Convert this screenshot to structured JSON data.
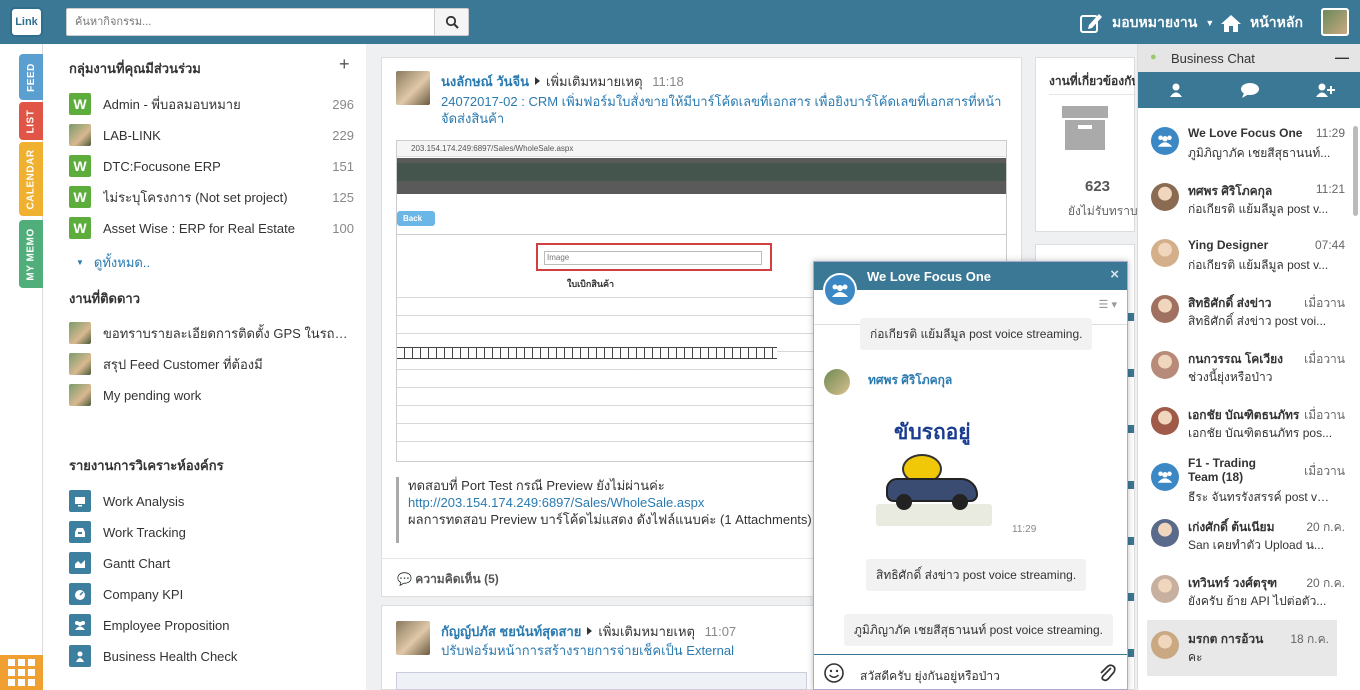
{
  "header": {
    "logo": "Link",
    "search_placeholder": "ค้นหากิจกรรม...",
    "assign_label": "มอบหมายงาน",
    "home_label": "หน้าหลัก"
  },
  "sidetabs": [
    "FEED",
    "LIST",
    "CALENDAR",
    "MY MEMO"
  ],
  "groups": {
    "title": "กลุ่มงานที่คุณมีส่วนร่วม",
    "add": "+",
    "items": [
      {
        "label": "Admin - พี่บอลมอบหมาย",
        "count": "296",
        "icon": "W"
      },
      {
        "label": "LAB-LINK",
        "count": "229",
        "icon": "photo"
      },
      {
        "label": "DTC:Focusone ERP",
        "count": "151",
        "icon": "W"
      },
      {
        "label": "ไม่ระบุโครงการ (Not set project)",
        "count": "125",
        "icon": "W"
      },
      {
        "label": "Asset Wise : ERP for Real Estate",
        "count": "100",
        "icon": "W"
      }
    ],
    "see_all": "ดูทั้งหมด.."
  },
  "follow": {
    "title": "งานที่ติดดาว",
    "items": [
      {
        "label": "ขอทราบรายละเอียดการติดตั้ง GPS ในรถโค..."
      },
      {
        "label": "สรุป Feed Customer ที่ต้องมี"
      },
      {
        "label": "My pending work"
      }
    ]
  },
  "reports": {
    "title": "รายงานการวิเคราะห์องค์กร",
    "items": [
      {
        "label": "Work Analysis",
        "icon": "monitor-icon"
      },
      {
        "label": "Work Tracking",
        "icon": "inbox-icon"
      },
      {
        "label": "Gantt Chart",
        "icon": "area-chart-icon"
      },
      {
        "label": "Company KPI",
        "icon": "dashboard-icon"
      },
      {
        "label": "Employee Proposition",
        "icon": "users-icon"
      },
      {
        "label": "Business Health Check",
        "icon": "user-icon"
      }
    ]
  },
  "post1": {
    "author": "นงลักษณ์ วันจีน",
    "action": "เพิ่มเติมหมายเหตุ",
    "time": "11:18",
    "title": "24072017-02 : CRM เพิ่มฟอร์มใบสั่งขายให้มีบาร์โค้ดเลขที่เอกสาร เพื่อยิงบาร์โค้ดเลขที่เอกสารที่หน้าจัดส่งสินค้า",
    "screenshot_url": "203.154.174.249:6897/Sales/WholeSale.aspx",
    "screenshot_back": "Back",
    "screenshot_img": "Image",
    "screenshot_doc_title": "ใบเบิกสินค้า",
    "quote_line1": "ทดสอบที่ Port Test กรณี Preview ยังไม่ผ่านค่ะ",
    "quote_link": "http://203.154.174.249:6897/Sales/WholeSale.aspx",
    "quote_line3": "ผลการทดสอบ Preview บาร์โค้ดไม่แสดง ดังไฟล์แนบค่ะ (1 Attachments)",
    "comments": "ความคิดเห็น (5)"
  },
  "post2": {
    "author": "กัญญ์ปภัส ชยนันท์สุดสาย",
    "action": "เพิ่มเติมหมายเหตุ",
    "time": "11:07",
    "title": "ปรับฟอร์มหน้าการสร้างรายการจ่ายเช็คเป็น External"
  },
  "mid": {
    "title": "งานที่เกี่ยวข้องกับ",
    "count": "623",
    "count_label": "ยังไม่รับทราบ"
  },
  "chatwin": {
    "title": "We Love Focus One",
    "close": "×",
    "messages": [
      {
        "text": "ก่อเกียรติ แย้มลีมูล post voice streaming."
      },
      {
        "sender": "ทศพร ศิริโภคกุล",
        "sticker_text": "ขับรถอยู่",
        "time": "11:29"
      },
      {
        "text": "สิทธิศักดิ์ ส่งข่าว post voice streaming."
      },
      {
        "text": "ภูมิภิญาภัค เชยสีสุธานนท์ post voice streaming."
      }
    ],
    "input_value": "สวัสดีครับ ยุ่งกันอยู่หรือป่าว"
  },
  "business_chat": {
    "title": "Business Chat",
    "minimize": "—",
    "items": [
      {
        "name": "We Love Focus One",
        "time": "11:29",
        "preview": "ภูมิภิญาภัค เชยสีสุธานนท์...",
        "avatar": "group"
      },
      {
        "name": "ทศพร ศิริโภคกุล",
        "time": "11:21",
        "preview": "ก่อเกียรติ แย้มลีมูล post v...",
        "avatar": "photo"
      },
      {
        "name": "Ying Designer",
        "time": "07:44",
        "preview": "ก่อเกียรติ แย้มลีมูล post v...",
        "avatar": "photo"
      },
      {
        "name": "สิทธิศักดิ์ ส่งข่าว",
        "time": "เมื่อวาน",
        "preview": "สิทธิศักดิ์ ส่งข่าว post voi...",
        "avatar": "photo"
      },
      {
        "name": "กนกวรรณ โคเวียง",
        "time": "เมื่อวาน",
        "preview": "ช่วงนี้ยุ่งหรือป่าว",
        "avatar": "photo"
      },
      {
        "name": "เอกชัย บัณฑิตธนภัทร",
        "time": "เมื่อวาน",
        "preview": "เอกชัย บัณฑิตธนภัทร pos...",
        "avatar": "photo"
      },
      {
        "name": "F1 - Trading Team (18)",
        "time": "เมื่อวาน",
        "preview": "ธีระ จันทรรังสรรค์ post vo...",
        "avatar": "group"
      },
      {
        "name": "เก่งศักดิ์ ต้นเนียม",
        "time": "20 ก.ค.",
        "preview": "San เคยทำตัว Upload น...",
        "avatar": "photo"
      },
      {
        "name": "เทวินทร์ วงศ์ตรุฑ",
        "time": "20 ก.ค.",
        "preview": "ยังครับ ย้าย API ไปต่อตัว...",
        "avatar": "photo"
      },
      {
        "name": "มรกต การอ้วน",
        "time": "18 ก.ค.",
        "preview": "คะ",
        "avatar": "photo"
      }
    ]
  },
  "colors": {
    "brand": "#3b7895",
    "link": "#2a7ab0",
    "green": "#5cad3c",
    "orange": "#f0a030"
  }
}
